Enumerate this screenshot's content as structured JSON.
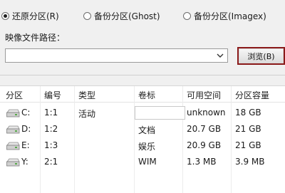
{
  "options": {
    "restore": "还原分区(R)",
    "backup_ghost": "备份分区(Ghost)",
    "backup_imagex": "备份分区(Imagex)"
  },
  "image_path": {
    "label": "映像文件路径：",
    "value": "",
    "browse_label": "浏览(B)"
  },
  "table": {
    "headers": [
      "分区",
      "编号",
      "类型",
      "卷标",
      "可用空间",
      "分区容量"
    ],
    "rows": [
      {
        "drive": "C:",
        "number": "1:1",
        "type": "活动",
        "label": "",
        "free": "unknown",
        "capacity": "18 GB"
      },
      {
        "drive": "D:",
        "number": "1:2",
        "type": "",
        "label": "文档",
        "free": "20.7 GB",
        "capacity": "21 GB"
      },
      {
        "drive": "E:",
        "number": "1:3",
        "type": "",
        "label": "娱乐",
        "free": "20.9 GB",
        "capacity": "21 GB"
      },
      {
        "drive": "Y:",
        "number": "2:1",
        "type": "",
        "label": "WIM",
        "free": "1.3 MB",
        "capacity": "3.9 MB"
      }
    ]
  },
  "colors": {
    "accent_border": "#8b1a1a"
  }
}
